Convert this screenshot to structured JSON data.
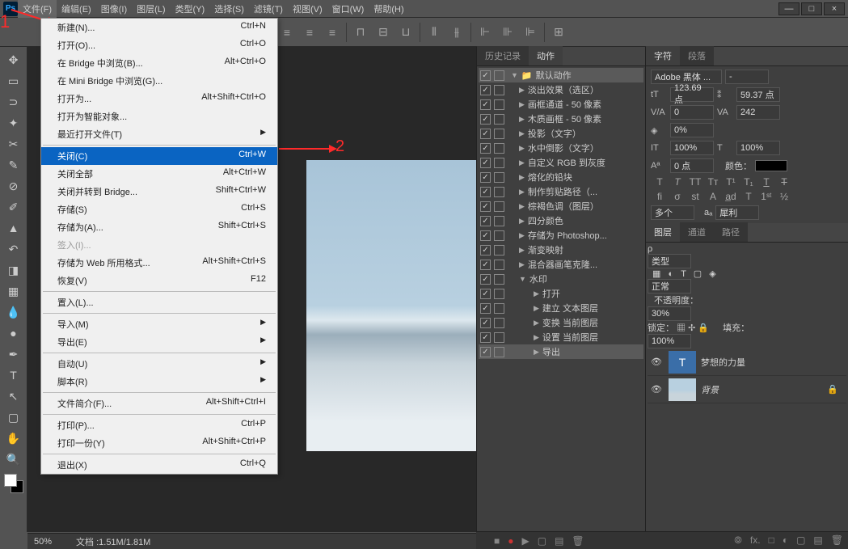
{
  "annotations": {
    "num1": "1",
    "num2": "2"
  },
  "menubar": [
    "文件(F)",
    "编辑(E)",
    "图像(I)",
    "图层(L)",
    "类型(Y)",
    "选择(S)",
    "滤镜(T)",
    "视图(V)",
    "窗口(W)",
    "帮助(H)"
  ],
  "win": {
    "min": "—",
    "max": "□",
    "close": "×"
  },
  "file_menu": [
    {
      "label": "新建(N)...",
      "short": "Ctrl+N"
    },
    {
      "label": "打开(O)...",
      "short": "Ctrl+O"
    },
    {
      "label": "在 Bridge 中浏览(B)...",
      "short": "Alt+Ctrl+O"
    },
    {
      "label": "在 Mini Bridge 中浏览(G)..."
    },
    {
      "label": "打开为...",
      "short": "Alt+Shift+Ctrl+O"
    },
    {
      "label": "打开为智能对象..."
    },
    {
      "label": "最近打开文件(T)",
      "sub": true
    },
    {
      "sep": true
    },
    {
      "label": "关闭(C)",
      "short": "Ctrl+W",
      "hl": true
    },
    {
      "label": "关闭全部",
      "short": "Alt+Ctrl+W"
    },
    {
      "label": "关闭并转到 Bridge...",
      "short": "Shift+Ctrl+W"
    },
    {
      "label": "存储(S)",
      "short": "Ctrl+S"
    },
    {
      "label": "存储为(A)...",
      "short": "Shift+Ctrl+S"
    },
    {
      "label": "签入(I)...",
      "disabled": true
    },
    {
      "label": "存储为 Web 所用格式...",
      "short": "Alt+Shift+Ctrl+S"
    },
    {
      "label": "恢复(V)",
      "short": "F12"
    },
    {
      "sep": true
    },
    {
      "label": "置入(L)..."
    },
    {
      "sep": true
    },
    {
      "label": "导入(M)",
      "sub": true
    },
    {
      "label": "导出(E)",
      "sub": true
    },
    {
      "sep": true
    },
    {
      "label": "自动(U)",
      "sub": true
    },
    {
      "label": "脚本(R)",
      "sub": true
    },
    {
      "sep": true
    },
    {
      "label": "文件简介(F)...",
      "short": "Alt+Shift+Ctrl+I"
    },
    {
      "sep": true
    },
    {
      "label": "打印(P)...",
      "short": "Ctrl+P"
    },
    {
      "label": "打印一份(Y)",
      "short": "Alt+Shift+Ctrl+P"
    },
    {
      "sep": true
    },
    {
      "label": "退出(X)",
      "short": "Ctrl+Q"
    }
  ],
  "history_tab": "历史记录",
  "actions_tab": "动作",
  "actions": [
    {
      "label": "默认动作",
      "folder": true,
      "open": true,
      "sel": true
    },
    {
      "label": "淡出效果（选区）",
      "open": false
    },
    {
      "label": "画框通道 - 50 像素",
      "open": false
    },
    {
      "label": "木质画框 - 50 像素",
      "open": false
    },
    {
      "label": "投影（文字）",
      "open": false
    },
    {
      "label": "水中倒影（文字）",
      "open": false
    },
    {
      "label": "自定义 RGB 到灰度",
      "open": false
    },
    {
      "label": "熔化的铅块",
      "open": false
    },
    {
      "label": "制作剪贴路径（...",
      "open": false
    },
    {
      "label": "棕褐色调（图层）",
      "open": false
    },
    {
      "label": "四分颜色",
      "open": false
    },
    {
      "label": "存储为 Photoshop...",
      "open": false
    },
    {
      "label": "渐变映射",
      "open": false
    },
    {
      "label": "混合器画笔克隆...",
      "open": false
    },
    {
      "label": "水印",
      "open": true
    },
    {
      "label": "打开",
      "child": true
    },
    {
      "label": "建立 文本图层",
      "child": true
    },
    {
      "label": "变换 当前图层",
      "child": true
    },
    {
      "label": "设置 当前图层",
      "child": true
    },
    {
      "label": "导出",
      "child": true,
      "sel": true
    }
  ],
  "char_tab": "字符",
  "para_tab": "段落",
  "char": {
    "font": "Adobe 黑体 ...",
    "style": "-",
    "size": "123.69 点",
    "leading": "59.37 点",
    "va": "0",
    "tracking": "242",
    "scale": "0%",
    "vscale": "100%",
    "hscale": "100%",
    "baseline": "0 点",
    "color_label": "颜色：",
    "lang": "多个",
    "aa": "犀利"
  },
  "layers_tab": "图层",
  "channels_tab": "通道",
  "paths_tab": "路径",
  "layers": {
    "filter": "类型",
    "blend": "正常",
    "opacity_label": "不透明度：",
    "opacity": "30%",
    "lock_label": "锁定：",
    "fill_label": "填充：",
    "fill": "100%",
    "layer1": "梦想的力量",
    "layer2": "背景"
  },
  "status": {
    "zoom": "50%",
    "doc": "文档 :1.51M/1.81M"
  },
  "icons": {
    "play": "▶",
    "rec": "●",
    "stop": "■",
    "fwd": "▸▸",
    "folder": "▢",
    "trash": "🗑",
    "fx": "fx.",
    "chain": "⦾",
    "mask": "□",
    "adj": "◐",
    "new": "▤"
  }
}
